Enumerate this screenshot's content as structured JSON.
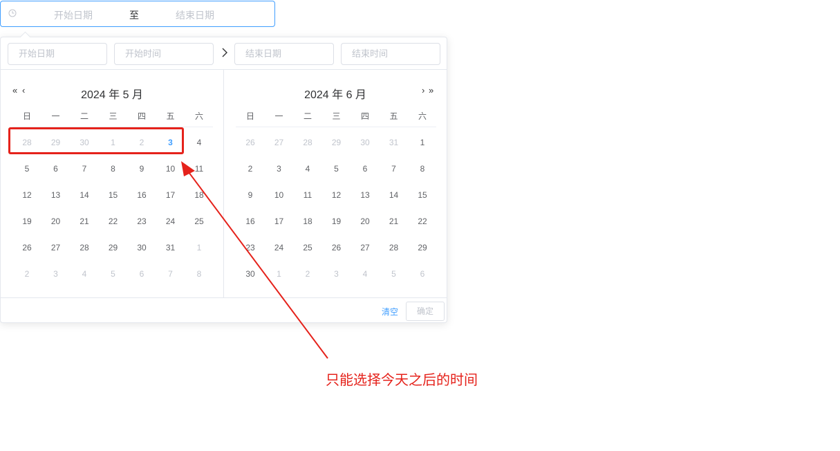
{
  "range_input": {
    "start_placeholder": "开始日期",
    "separator": "至",
    "end_placeholder": "结束日期"
  },
  "panel_header": {
    "start_date_placeholder": "开始日期",
    "start_time_placeholder": "开始时间",
    "end_date_placeholder": "结束日期",
    "end_time_placeholder": "结束时间"
  },
  "weekdays": [
    "日",
    "一",
    "二",
    "三",
    "四",
    "五",
    "六"
  ],
  "left_calendar": {
    "title": "2024 年 5 月",
    "rows": [
      [
        "28",
        "29",
        "30",
        "1",
        "2",
        "3",
        "4"
      ],
      [
        "5",
        "6",
        "7",
        "8",
        "9",
        "10",
        "11"
      ],
      [
        "12",
        "13",
        "14",
        "15",
        "16",
        "17",
        "18"
      ],
      [
        "19",
        "20",
        "21",
        "22",
        "23",
        "24",
        "25"
      ],
      [
        "26",
        "27",
        "28",
        "29",
        "30",
        "31",
        "1"
      ],
      [
        "2",
        "3",
        "4",
        "5",
        "6",
        "7",
        "8"
      ]
    ]
  },
  "right_calendar": {
    "title": "2024 年 6 月",
    "rows": [
      [
        "26",
        "27",
        "28",
        "29",
        "30",
        "31",
        "1"
      ],
      [
        "2",
        "3",
        "4",
        "5",
        "6",
        "7",
        "8"
      ],
      [
        "9",
        "10",
        "11",
        "12",
        "13",
        "14",
        "15"
      ],
      [
        "16",
        "17",
        "18",
        "19",
        "20",
        "21",
        "22"
      ],
      [
        "23",
        "24",
        "25",
        "26",
        "27",
        "28",
        "29"
      ],
      [
        "30",
        "1",
        "2",
        "3",
        "4",
        "5",
        "6"
      ]
    ]
  },
  "footer": {
    "clear_label": "清空",
    "confirm_label": "确定"
  },
  "annotation": {
    "text": "只能选择今天之后的时间",
    "color": "#e5221b"
  },
  "colors": {
    "accent": "#409eff",
    "muted": "#c0c4cc",
    "text": "#606266"
  }
}
